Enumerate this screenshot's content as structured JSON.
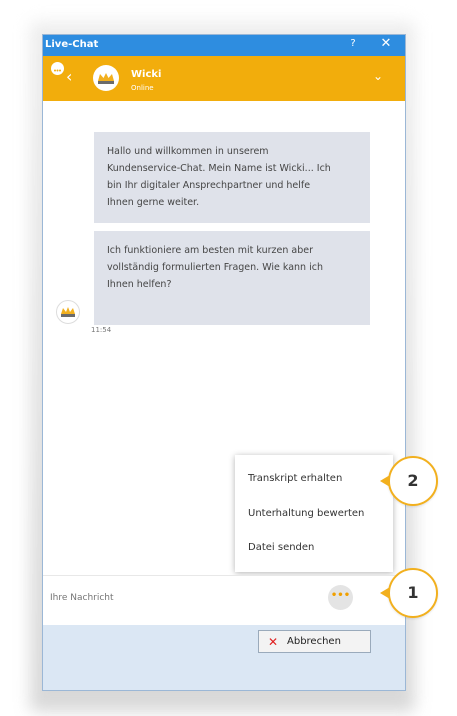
{
  "window": {
    "title": "Live-Chat",
    "help": "?",
    "close": "✕"
  },
  "header": {
    "agent_name": "Wicki",
    "agent_status": "Online",
    "back": "‹",
    "chevron": "⌄"
  },
  "messages": [
    {
      "lines": [
        "Hallo und willkommen in unserem",
        "Kundenservice-Chat. Mein Name ist Wicki... Ich",
        "bin Ihr digitaler Ansprechpartner und helfe",
        "Ihnen gerne weiter."
      ]
    },
    {
      "lines": [
        "Ich funktioniere am besten mit kurzen aber",
        "vollständig formulierten Fragen. Wie kann ich",
        "Ihnen helfen?"
      ]
    }
  ],
  "message_time": "11:54",
  "menu": {
    "items": [
      "Transkript erhalten",
      "Unterhaltung bewerten",
      "Datei senden"
    ]
  },
  "input": {
    "placeholder": "Ihre Nachricht",
    "more_label": "•••"
  },
  "footer": {
    "cancel_label": "Abbrechen",
    "cancel_icon": "✕"
  },
  "callouts": [
    "1",
    "2"
  ],
  "colors": {
    "titlebar": "#2e8de0",
    "accent": "#f2ad0c",
    "bubble": "#dfe2ea",
    "footer": "#dbe7f4"
  }
}
